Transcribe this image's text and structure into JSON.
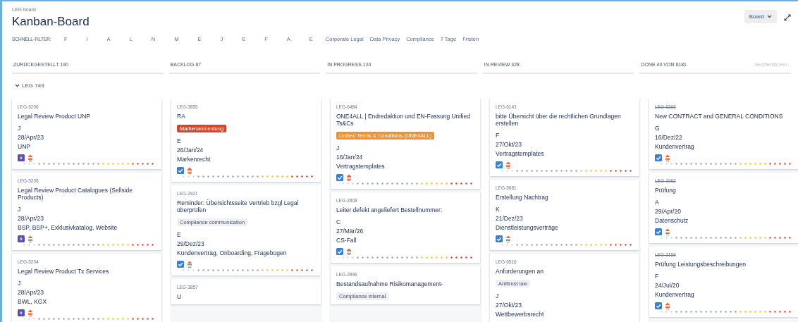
{
  "breadcrumb": "LEG board",
  "title": "Kanban-Board",
  "board_button": "Board",
  "quick_filter_label": "SCHNELL-FILTER:",
  "quick_filters": [
    "F",
    "I",
    "A",
    "L",
    "N",
    "M",
    "E",
    "J",
    "E",
    "F",
    "A",
    "E",
    "Corporate Legal",
    "Data Privacy",
    "Compliance",
    "7 Tage",
    "Fristen"
  ],
  "swimlane": {
    "label": "LEG 749",
    "expanded": true
  },
  "columns": [
    {
      "title": "ZURÜCKGESTELLT 190",
      "cards": [
        {
          "key": "LEG-5206",
          "summary": "Legal Review Product UNP",
          "assignee": "J",
          "date": "28/Apr/23",
          "component": "UNP",
          "kind": "story",
          "done": false
        },
        {
          "key": "LEG-5205",
          "summary": "Legal Review Product Catalogues (Sellside Products)",
          "assignee": "J",
          "date": "28/Apr/23",
          "component": "BSP, BSP+, Exklusivkatalog, Website",
          "kind": "story",
          "done": false
        },
        {
          "key": "LEG-5204",
          "summary": "Legal Review Product Tx Services",
          "assignee": "J",
          "date": "28/Apr/23",
          "component": "BWL, KGX",
          "kind": "story",
          "done": false
        }
      ]
    },
    {
      "title": "BACKLOG 67",
      "cards": [
        {
          "key": "LEG-3855",
          "summary": "RA",
          "label": "Markenanmeldung",
          "color": "#d8452a",
          "assignee": "E",
          "date": "26/Jan/24",
          "component": "Markenrecht",
          "kind": "task",
          "done": false
        },
        {
          "key": "LEG-2921",
          "summary": "Reminder: Übersichtsseite Vertrieb bzgl Legal überprüfen",
          "label": "Compliance communication",
          "color": "#eef0f3",
          "assignee": "E",
          "date": "29/Dez/23",
          "component": "Kundenvertrag, Onboarding, Fragebogen",
          "kind": "task",
          "done": false
        },
        {
          "key": "LEG-3857",
          "summary": "U"
        }
      ]
    },
    {
      "title": "IN PROGRESS 124",
      "cards": [
        {
          "key": "LEG-6484",
          "summary": "ONE4ALL | Endredaktion und EN-Fassung Unified Ts&Cs",
          "label": "Unified Terms & Conditions (ONE4ALL)",
          "color": "#f0922e",
          "assignee": "J",
          "date": "16/Jan/24",
          "component": "Vertragstemplates",
          "kind": "task",
          "done": false
        },
        {
          "key": "LEG-2808",
          "summary": "Leiter defekt angeliefert Bestellnummer:",
          "assignee": "C",
          "date": "27/Mär/26",
          "component": "CS-Fall",
          "kind": "task",
          "done": false
        },
        {
          "key": "LEG-2896",
          "summary": "Bestandsaufnahme Risikomanagement-",
          "label": "Compliance internal",
          "color": "#eef0f3"
        }
      ]
    },
    {
      "title": "IN REVIEW 328",
      "cards": [
        {
          "key": "LEG-6143",
          "summary": "bitte Übersicht über die rechtlichen Grundlagen erstellen",
          "assignee": "F",
          "date": "27/Okt/23",
          "component": "Vertragstemplates",
          "kind": "task",
          "done": false
        },
        {
          "key": "LEG-5681",
          "summary": "Erstellung Nachtrag",
          "assignee": "K",
          "date": "21/Dez/23",
          "component": "Dienstleistungsverträge",
          "kind": "task",
          "done": false
        },
        {
          "key": "LEG-6516",
          "summary": "Anforderungen an",
          "label": "Antitrust law",
          "color": "#eef0f3",
          "assignee": "J",
          "date": "27/Okt/23",
          "component": "Wettbewerbsrecht"
        }
      ]
    },
    {
      "title": "DONE 40 VON 6181",
      "action": "Veröffentlichen...",
      "cards": [
        {
          "key": "LEG-5393",
          "summary": "New CONTRACT and GENERAL CONDITIONS",
          "assignee": "G",
          "date": "16/Dez/22",
          "component": "Kundenvertrag",
          "kind": "task",
          "done": true
        },
        {
          "key": "LEG-1062",
          "summary": "Prüfung",
          "assignee": "A",
          "date": "29/Apr/20",
          "component": "Datenschutz",
          "kind": "task",
          "done": true
        },
        {
          "key": "LEG-2159",
          "summary": "Prüfung Leistungsbeschreibungen",
          "assignee": "F",
          "date": "24/Jul/20",
          "component": "Kundenvertrag",
          "kind": "task",
          "done": true
        }
      ]
    }
  ]
}
